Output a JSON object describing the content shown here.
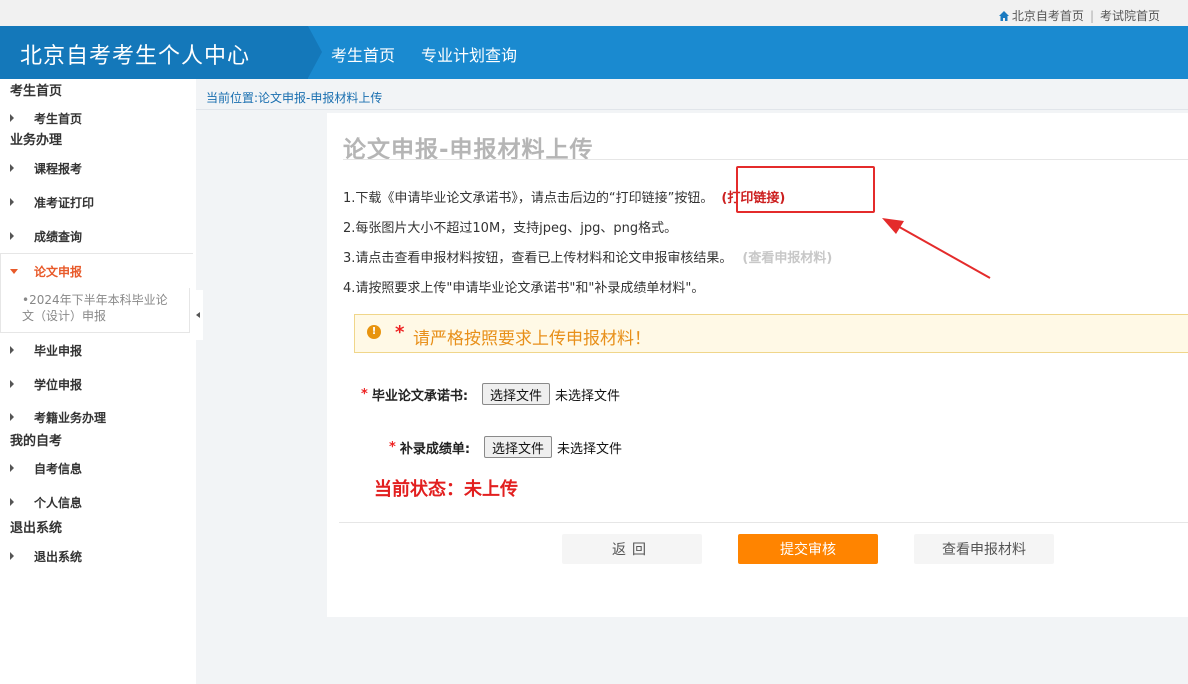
{
  "topbar": {
    "home_link": "北京自考首页",
    "exam_link": "考试院首页"
  },
  "header": {
    "title": "北京自考考生个人中心",
    "nav": [
      "考生首页",
      "专业计划查询"
    ]
  },
  "sidebar": {
    "groups": [
      {
        "title": "考生首页",
        "items": [
          "考生首页"
        ]
      },
      {
        "title": "业务办理",
        "items": [
          "课程报考",
          "准考证打印",
          "成绩查询",
          "论文申报",
          "毕业申报",
          "学位申报",
          "考籍业务办理"
        ]
      },
      {
        "title": "我的自考",
        "items": [
          "自考信息",
          "个人信息"
        ]
      },
      {
        "title": "退出系统",
        "items": [
          "退出系统"
        ]
      }
    ],
    "active_item": "论文申报",
    "active_sub": "•2024年下半年本科毕业论文（设计）申报"
  },
  "breadcrumb": "当前位置:论文申报-申报材料上传",
  "panel": {
    "title": "论文申报-申报材料上传",
    "instructions": {
      "line1": "1.下载《申请毕业论文承诺书》，请点击后边的“打印链接”按钮。",
      "line1_link": "(打印链接)",
      "line2": "2.每张图片大小不超过10M，支持jpeg、jpg、png格式。",
      "line3": "3.请点击查看申报材料按钮，查看已上传材料和论文申报审核结果。",
      "line3_link": "(查看申报材料)",
      "line4": "4.请按照要求上传\"申请毕业论文承诺书\"和\"补录成绩单材料\"。"
    },
    "notice": {
      "star": "*",
      "message": "请严格按照要求上传申报材料！"
    },
    "fields": [
      {
        "required": "*",
        "label": "毕业论文承诺书:",
        "button": "选择文件",
        "status": "未选择文件"
      },
      {
        "required": "*",
        "label": "补录成绩单:",
        "button": "选择文件",
        "status": "未选择文件"
      }
    ],
    "current_status": "当前状态：未上传",
    "buttons": {
      "back": "返回",
      "submit": "提交审核",
      "view": "查看申报材料"
    }
  },
  "colors": {
    "header_blue": "#1a8ad0",
    "brand_blue": "#1478ba",
    "accent_orange": "#ff8400",
    "alert_red": "#e21f1f"
  }
}
